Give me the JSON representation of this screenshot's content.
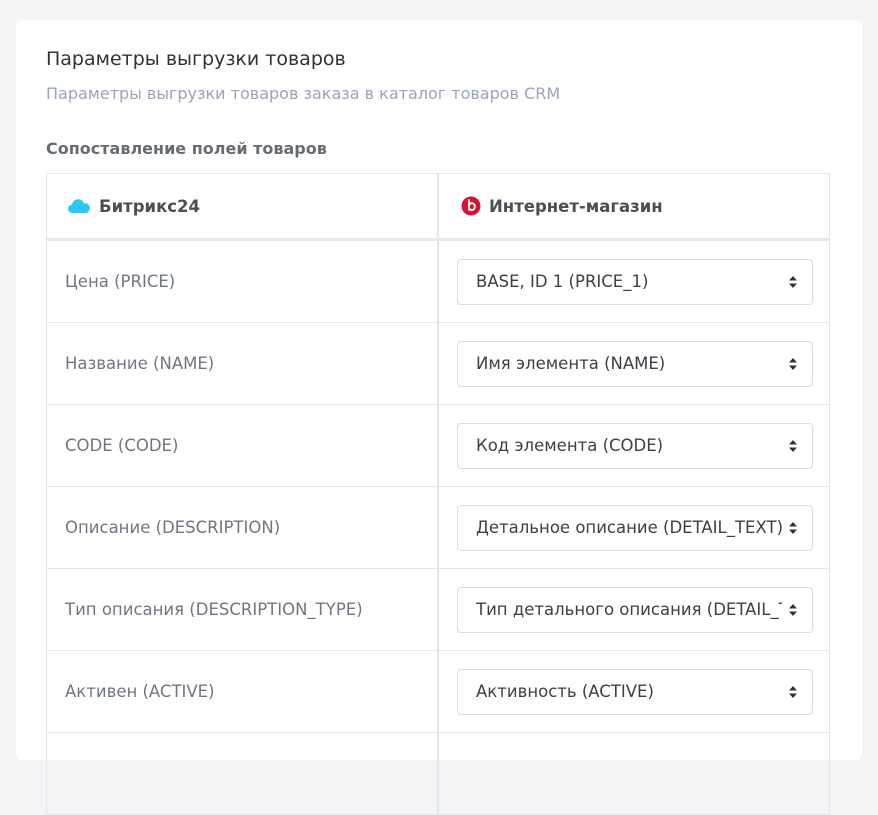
{
  "header": {
    "title": "Параметры выгрузки товаров",
    "subtitle": "Параметры выгрузки товаров заказа в каталог товаров CRM"
  },
  "section": {
    "title": "Сопоставление полей товаров"
  },
  "table": {
    "columns": [
      {
        "label": "Битрикс24",
        "icon": "cloud-icon",
        "icon_color": "#2fc7f7"
      },
      {
        "label": "Интернет-магазин",
        "icon": "shop-logo-icon",
        "icon_color": "#d5133a"
      }
    ],
    "rows": [
      {
        "field": "Цена (PRICE)",
        "selected": "BASE, ID 1 (PRICE_1)"
      },
      {
        "field": "Название (NAME)",
        "selected": "Имя элемента (NAME)"
      },
      {
        "field": "CODE (CODE)",
        "selected": "Код элемента (CODE)"
      },
      {
        "field": "Описание (DESCRIPTION)",
        "selected": "Детальное описание (DETAIL_TEXT)"
      },
      {
        "field": "Тип описания (DESCRIPTION_TYPE)",
        "selected": "Тип детального описания (DETAIL_TEXT_TYPE)"
      },
      {
        "field": "Активен (ACTIVE)",
        "selected": "Активность (ACTIVE)"
      }
    ]
  },
  "colors": {
    "page_bg": "#f3f4f6",
    "card_bg": "#ffffff",
    "border": "#e2e5ea",
    "subtitle": "#9aa4b8"
  }
}
